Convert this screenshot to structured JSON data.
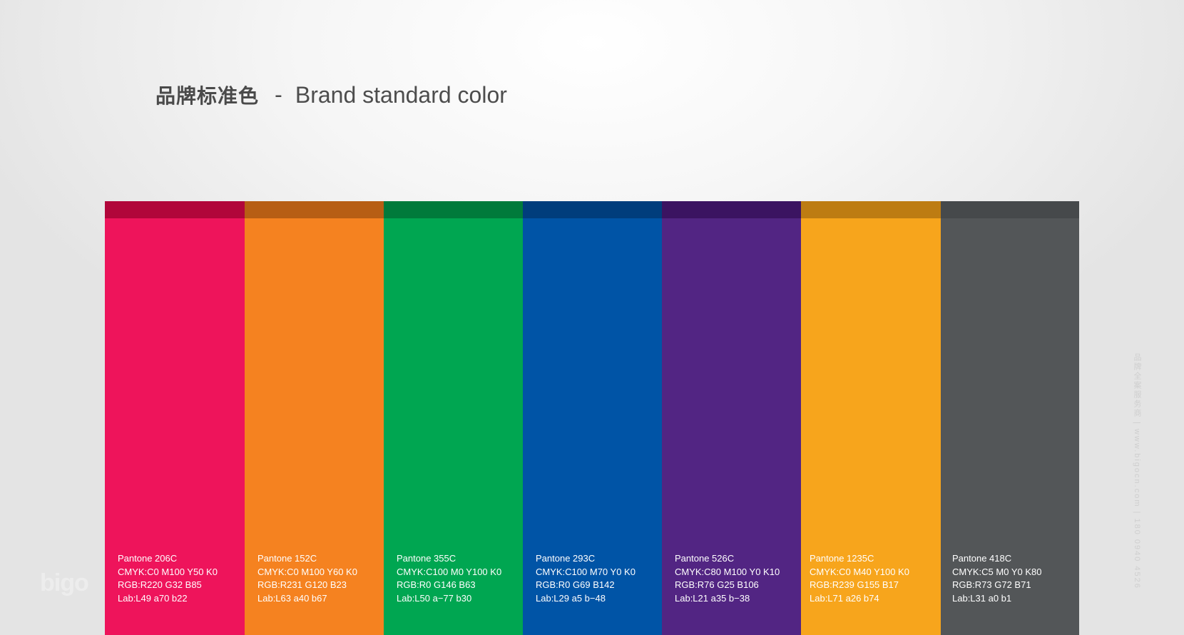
{
  "title": {
    "cn": "品牌标准色",
    "separator": "-",
    "en": "Brand standard color"
  },
  "swatches": [
    {
      "main": "#ee145b",
      "top": "#b1063a",
      "pantone": "Pantone 206C",
      "cmyk": "CMYK:C0 M100 Y50 K0",
      "rgb": "RGB:R220 G32 B85",
      "lab": "Lab:L49 a70 b22"
    },
    {
      "main": "#f58220",
      "top": "#b75e14",
      "pantone": "Pantone 152C",
      "cmyk": "CMYK:C0 M100 Y60 K0",
      "rgb": "RGB:R231 G120 B23",
      "lab": "Lab:L63 a40 b67"
    },
    {
      "main": "#00a651",
      "top": "#007a3b",
      "pantone": "Pantone 355C",
      "cmyk": "CMYK:C100 M0 Y100 K0",
      "rgb": "RGB:R0 G146 B63",
      "lab": "Lab:L50 a−77 b30"
    },
    {
      "main": "#0054a6",
      "top": "#003d7c",
      "pantone": "Pantone 293C",
      "cmyk": "CMYK:C100 M70 Y0 K0",
      "rgb": "RGB:R0 G69 B142",
      "lab": "Lab:L29 a5 b−48"
    },
    {
      "main": "#522583",
      "top": "#3b1461",
      "pantone": "Pantone 526C",
      "cmyk": "CMYK:C80 M100 Y0 K10",
      "rgb": "RGB:R76 G25 B106",
      "lab": "Lab:L21 a35 b−38"
    },
    {
      "main": "#f7a51c",
      "top": "#bd7c12",
      "pantone": "Pantone 1235C",
      "cmyk": "CMYK:C0 M40 Y100 K0",
      "rgb": "RGB:R239 G155 B17",
      "lab": "Lab:L71 a26 b74"
    },
    {
      "main": "#535658",
      "top": "#46494b",
      "pantone": "Pantone 418C",
      "cmyk": "CMYK:C5 M0 Y0 K80",
      "rgb": "RGB:R73 G72 B71",
      "lab": "Lab:L31 a0 b1"
    }
  ],
  "watermark": {
    "logo_text": "bigo",
    "side_text": "品牌全案服务商 | www.bigocn.com | 180 0940 4526"
  }
}
